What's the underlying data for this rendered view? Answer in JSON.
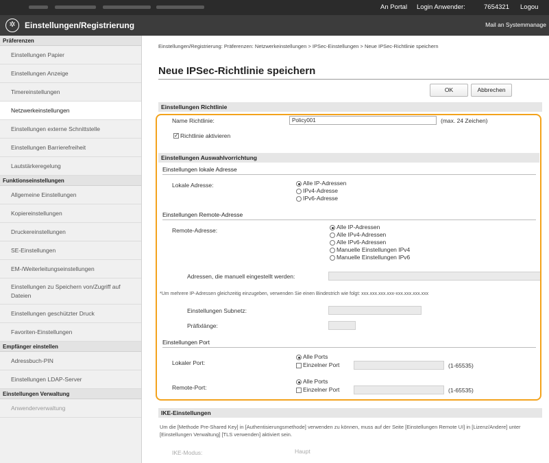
{
  "header": {
    "links": {
      "portal": "An Portal",
      "login_label": "Login Anwender:",
      "login_id": "7654321",
      "logout": "Logou"
    },
    "title": "Einstellungen/Registrierung",
    "mail": "Mail an Systemmanage"
  },
  "sidebar": {
    "sections": [
      {
        "title": "Präferenzen",
        "items": [
          "Einstellungen Papier",
          "Einstellungen Anzeige",
          "Timereinstellungen",
          "Netzwerkeinstellungen",
          "Einstellungen externe Schnittstelle",
          "Einstellungen Barrierefreiheit",
          "Lautstärkeregelung"
        ]
      },
      {
        "title": "Funktionseinstellungen",
        "items": [
          "Allgemeine Einstellungen",
          "Kopiereinstellungen",
          "Druckereinstellungen",
          "SE-Einstellungen",
          "EM-/Weiterleitungseinstellungen",
          "Einstellungen zu Speichern von/Zugriff auf Dateien",
          "Einstellungen geschützter Druck",
          "Favoriten-Einstellungen"
        ]
      },
      {
        "title": "Empfänger einstellen",
        "items": [
          "Adressbuch-PIN",
          "Einstellungen LDAP-Server"
        ]
      },
      {
        "title": "Einstellungen Verwaltung",
        "items": [
          "Anwenderverwaltung"
        ]
      }
    ],
    "active_item": "Netzwerkeinstellungen"
  },
  "main": {
    "breadcrumb": "Einstellungen/Registrierung: Präferenzen: Netzwerkeinstellungen > IPSec-Einstellungen > Neue IPSec-Richtlinie speichern",
    "title": "Neue IPSec-Richtlinie speichern",
    "ok_label": "OK",
    "cancel_label": "Abbrechen",
    "policy": {
      "header": "Einstellungen Richtlinie",
      "name_label": "Name Richtlinie:",
      "name_value": "Policy001",
      "name_hint": "(max. 24 Zeichen)",
      "enable_label": "Richtlinie aktivieren",
      "enabled": true
    },
    "selector": {
      "header": "Einstellungen Auswahlvorrichtung",
      "local": {
        "header": "Einstellungen lokale Adresse",
        "label": "Lokale Adresse:",
        "options": [
          "Alle IP-Adressen",
          "IPv4-Adresse",
          "IPv6-Adresse"
        ],
        "selected": 0
      },
      "remote": {
        "header": "Einstellungen Remote-Adresse",
        "label": "Remote-Adresse:",
        "options": [
          "Alle IP-Adressen",
          "Alle IPv4-Adressen",
          "Alle IPv6-Adressen",
          "Manuelle Einstellungen IPv4",
          "Manuelle Einstellungen IPv6"
        ],
        "selected": 0,
        "manual_label": "Adressen, die manuell eingestellt werden:",
        "manual_hint": "*Um mehrere IP-Adressen gleichzeitig einzugeben, verwenden Sie einen Bindestrich wie folgt: xxx.xxx.xxx.xxx-xxx.xxx.xxx.xxx",
        "subnet_label": "Einstellungen Subnetz:",
        "prefix_label": "Präfixlänge:"
      },
      "port": {
        "header": "Einstellungen Port",
        "local_label": "Lokaler Port:",
        "remote_label": "Remote-Port:",
        "all_ports": "Alle Ports",
        "single_port": "Einzelner Port",
        "range_hint": "(1-65535)"
      }
    },
    "ike": {
      "header": "IKE-Einstellungen",
      "note": "Um die [Methode Pre-Shared Key] in [Authentisierungsmethode] verwenden zu können, muss auf der Seite [Einstellungen Remote UI] in [Lizenz/Andere] unter [Einstellungen Verwaltung] [TLS verwenden] aktiviert sein.",
      "mode_label": "IKE-Modus:",
      "mode_value": "Haupt"
    }
  }
}
